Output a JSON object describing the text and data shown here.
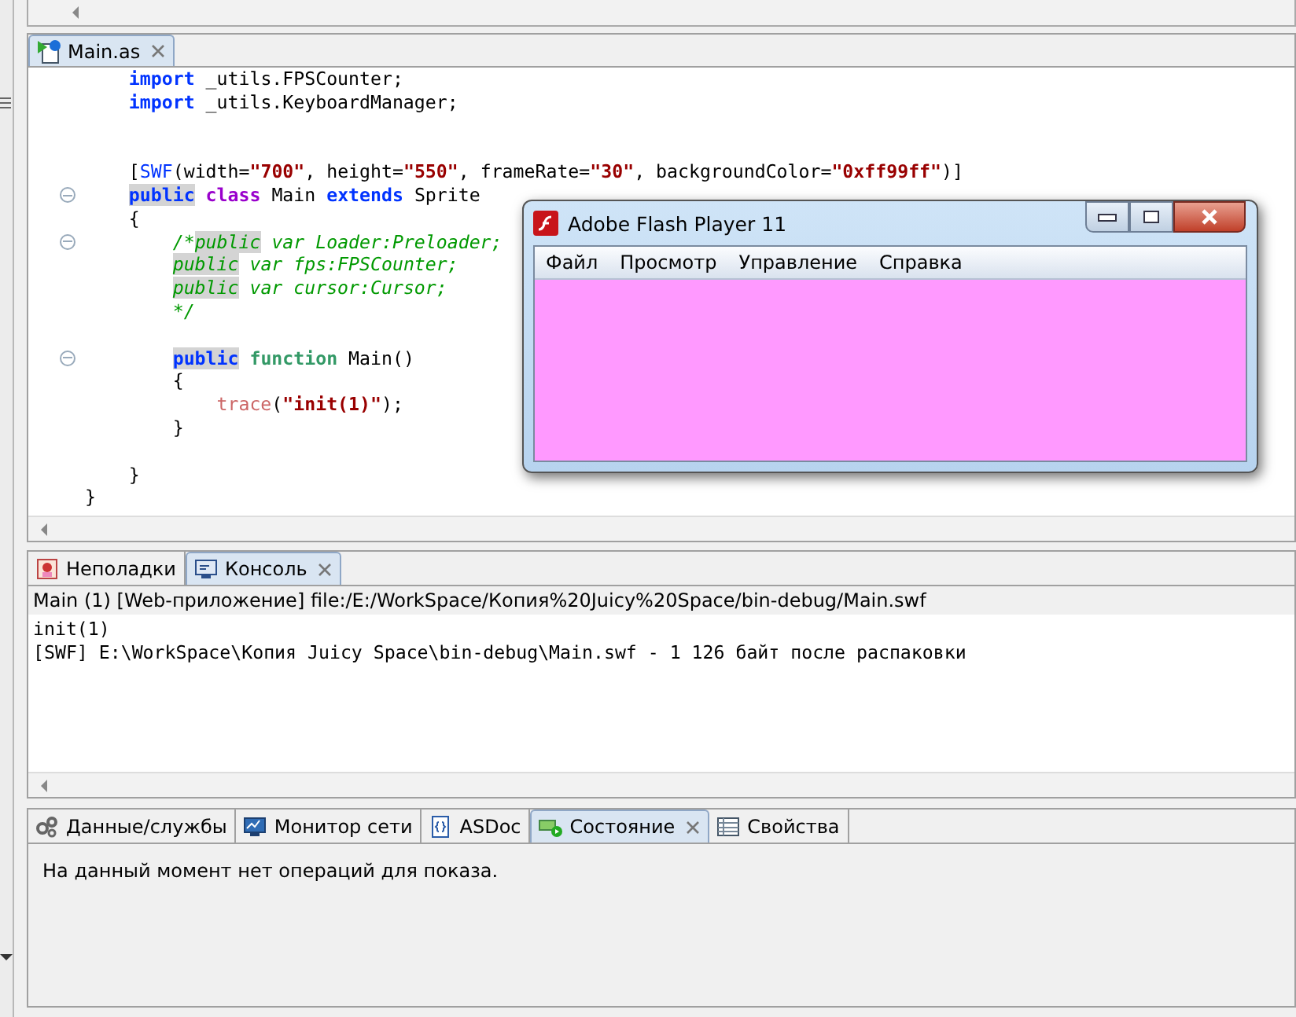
{
  "editor": {
    "tabs": [
      {
        "label": "Main.as",
        "selected": true,
        "closable": true
      }
    ],
    "lines": [
      {
        "fold": false,
        "tokens": [
          {
            "kind": "keyword",
            "text": "    import"
          },
          {
            "kind": "plain",
            "text": " _utils.FPSCounter;"
          }
        ]
      },
      {
        "fold": false,
        "tokens": [
          {
            "kind": "keyword",
            "text": "    import"
          },
          {
            "kind": "plain",
            "text": " _utils.KeyboardManager;"
          }
        ]
      },
      {
        "fold": false
      },
      {
        "fold": false
      },
      {
        "fold": false,
        "tokens": [
          {
            "kind": "plain",
            "text": "    ["
          },
          {
            "kind": "meta",
            "text": "SWF"
          },
          {
            "kind": "plain",
            "text": "(width="
          },
          {
            "kind": "string",
            "text": "\"700\""
          },
          {
            "kind": "plain",
            "text": ", height="
          },
          {
            "kind": "string",
            "text": "\"550\""
          },
          {
            "kind": "plain",
            "text": ", frameRate="
          },
          {
            "kind": "string",
            "text": "\"30\""
          },
          {
            "kind": "plain",
            "text": ", backgroundColor="
          },
          {
            "kind": "string",
            "text": "\"0xff99ff\""
          },
          {
            "kind": "plain",
            "text": ")]"
          }
        ]
      },
      {
        "fold": true,
        "tokens": [
          {
            "kind": "keyword-mark",
            "text": "    public"
          },
          {
            "kind": "class",
            "text": " class"
          },
          {
            "kind": "plain",
            "text": " Main "
          },
          {
            "kind": "keyword",
            "text": "extends"
          },
          {
            "kind": "plain",
            "text": " Sprite"
          }
        ]
      },
      {
        "fold": false,
        "tokens": [
          {
            "kind": "plain",
            "text": "    {"
          }
        ]
      },
      {
        "fold": true,
        "tokens": [
          {
            "kind": "comment",
            "text": "        /*"
          },
          {
            "kind": "comment-mark",
            "text": "public"
          },
          {
            "kind": "comment",
            "text": " var Loader:Preloader;"
          }
        ]
      },
      {
        "fold": false,
        "tokens": [
          {
            "kind": "comment-mark",
            "text": "        public"
          },
          {
            "kind": "comment",
            "text": " var fps:FPSCounter;"
          }
        ]
      },
      {
        "fold": false,
        "tokens": [
          {
            "kind": "comment-mark",
            "text": "        public"
          },
          {
            "kind": "comment",
            "text": " var cursor:Cursor;"
          }
        ]
      },
      {
        "fold": false,
        "tokens": [
          {
            "kind": "comment",
            "text": "        */"
          }
        ]
      },
      {
        "fold": false
      },
      {
        "fold": true,
        "tokens": [
          {
            "kind": "keyword-mark",
            "text": "        public"
          },
          {
            "kind": "function",
            "text": " function"
          },
          {
            "kind": "plain",
            "text": " Main()"
          }
        ]
      },
      {
        "fold": false,
        "tokens": [
          {
            "kind": "plain",
            "text": "        {"
          }
        ]
      },
      {
        "fold": false,
        "tokens": [
          {
            "kind": "call",
            "text": "            trace"
          },
          {
            "kind": "plain",
            "text": "("
          },
          {
            "kind": "string",
            "text": "\"init(1)\""
          },
          {
            "kind": "plain",
            "text": ");"
          }
        ]
      },
      {
        "fold": false,
        "tokens": [
          {
            "kind": "plain",
            "text": "        }"
          }
        ]
      },
      {
        "fold": false
      },
      {
        "fold": false,
        "tokens": [
          {
            "kind": "plain",
            "text": "    }"
          }
        ]
      },
      {
        "fold": false,
        "tokens": [
          {
            "kind": "plain",
            "text": "}"
          }
        ]
      }
    ]
  },
  "flash_window": {
    "title": "Adobe Flash Player 11",
    "menu": [
      "Файл",
      "Просмотр",
      "Управление",
      "Справка"
    ]
  },
  "console": {
    "tabs": [
      {
        "label": "Неполадки",
        "selected": false,
        "closable": false
      },
      {
        "label": "Консоль",
        "selected": true,
        "closable": true
      }
    ],
    "header": "Main (1) [Web-приложение] file:/E:/WorkSpace/Копия%20Juicy%20Space/bin-debug/Main.swf",
    "output": [
      "init(1)",
      "[SWF] E:\\WorkSpace\\Копия Juicy Space\\bin-debug\\Main.swf - 1 126 байт после распаковки"
    ]
  },
  "bottom": {
    "tabs": [
      {
        "label": "Данные/службы",
        "selected": false,
        "closable": false
      },
      {
        "label": "Монитор сети",
        "selected": false,
        "closable": false
      },
      {
        "label": "ASDoc",
        "selected": false,
        "closable": false
      },
      {
        "label": "Состояние",
        "selected": true,
        "closable": true
      },
      {
        "label": "Свойства",
        "selected": false,
        "closable": false
      }
    ],
    "message": "На данный момент нет операций для показа."
  }
}
